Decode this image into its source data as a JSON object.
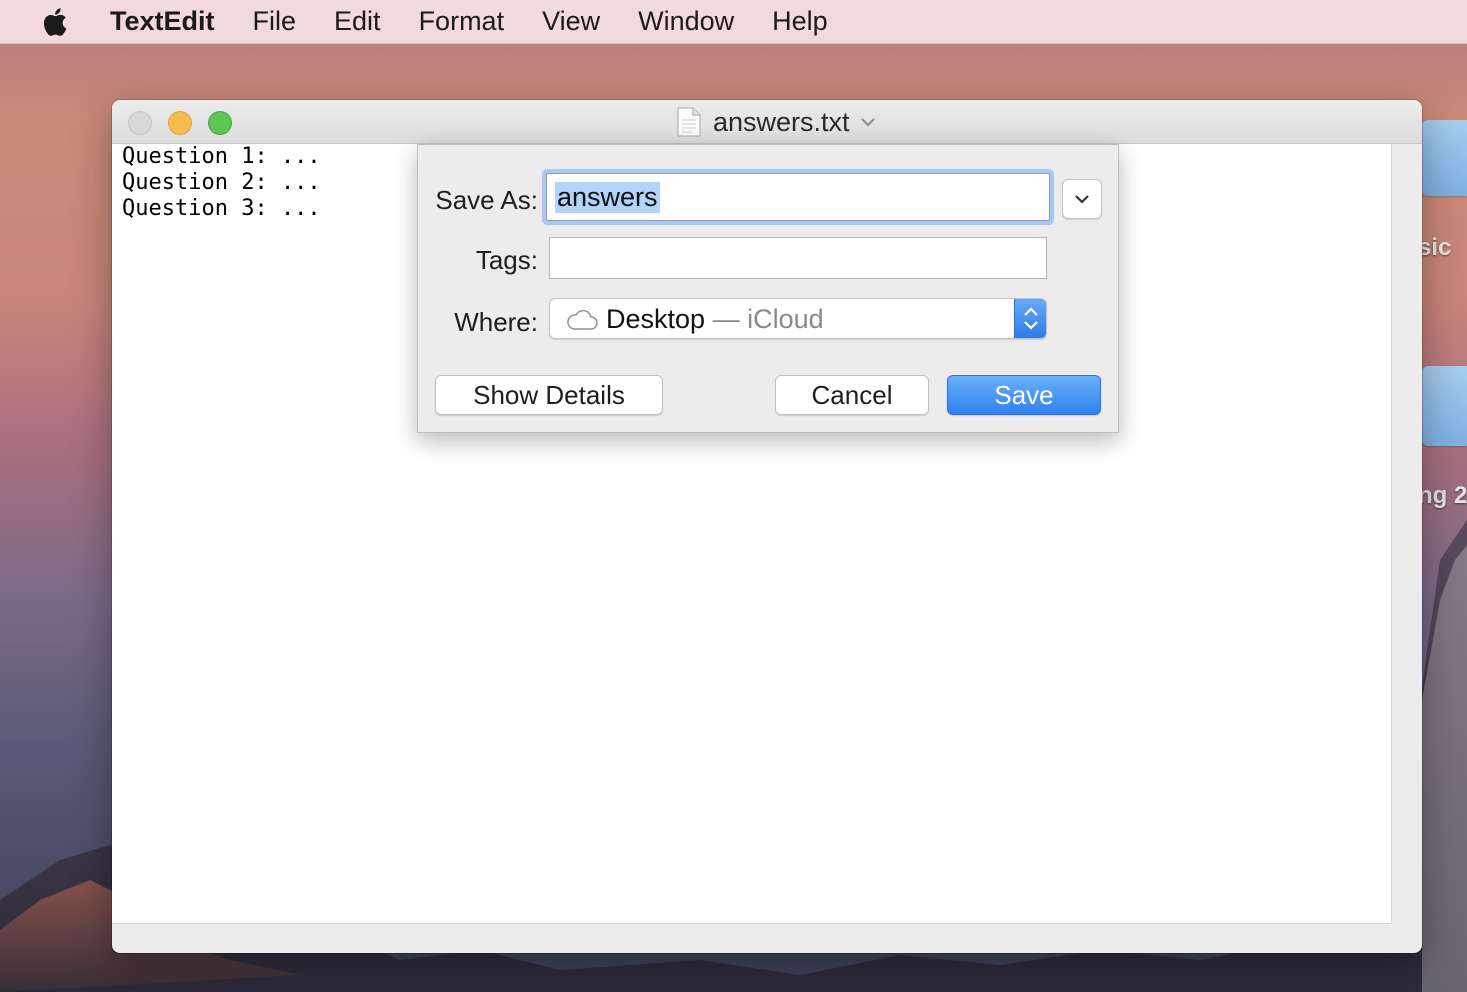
{
  "menubar": {
    "app_name": "TextEdit",
    "items": [
      "File",
      "Edit",
      "Format",
      "View",
      "Window",
      "Help"
    ]
  },
  "desktop": {
    "side_labels": [
      "sic",
      "ng 2"
    ]
  },
  "window": {
    "title": "answers.txt",
    "document_lines": [
      "Question 1: ...",
      "Question 2: ...",
      "Question 3: ..."
    ]
  },
  "save_dialog": {
    "save_as_label": "Save As:",
    "save_as_value": "answers",
    "tags_label": "Tags:",
    "tags_value": "",
    "where_label": "Where:",
    "where_location": "Desktop",
    "where_separator": " — ",
    "where_service": "iCloud",
    "show_details_label": "Show Details",
    "cancel_label": "Cancel",
    "save_label": "Save"
  },
  "colors": {
    "accent_blue": "#2f80f0",
    "focus_ring": "#a7c8f2",
    "selection": "#b3d3fb"
  }
}
